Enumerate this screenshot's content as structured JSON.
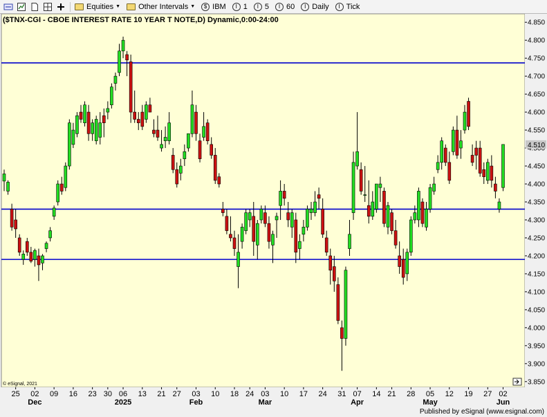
{
  "toolbar": {
    "items": [
      {
        "label": "Equities",
        "icon": "folder-icon",
        "dropdown": true
      },
      {
        "label": "Other Intervals",
        "icon": "folder-icon",
        "dropdown": true
      },
      {
        "label": "IBM",
        "icon": "symbol-icon",
        "glyph": "$"
      },
      {
        "label": "1",
        "icon": "interval-icon",
        "glyph": "I"
      },
      {
        "label": "5",
        "icon": "interval-icon",
        "glyph": "I"
      },
      {
        "label": "60",
        "icon": "interval-icon",
        "glyph": "I"
      },
      {
        "label": "Daily",
        "icon": "interval-icon",
        "glyph": "I"
      },
      {
        "label": "Tick",
        "icon": "interval-icon",
        "glyph": "I"
      }
    ]
  },
  "footer": {
    "published": "Published by eSignal (www.esignal.com)"
  },
  "chart_data": {
    "type": "candlestick",
    "title": "($TNX-CGI - CBOE INTEREST RATE 10 YEAR T NOTE,D) Dynamic,0:00-24:00",
    "copyright": "© eSignal, 2021",
    "ylim": [
      3.84,
      4.86
    ],
    "yticks": [
      "4.850",
      "4.800",
      "4.750",
      "4.700",
      "4.650",
      "4.600",
      "4.550",
      "4.500",
      "4.450",
      "4.400",
      "4.350",
      "4.300",
      "4.250",
      "4.200",
      "4.150",
      "4.100",
      "4.050",
      "4.000",
      "3.950",
      "3.900",
      "3.850"
    ],
    "last_price": "4.510",
    "horizontal_lines": [
      4.737,
      4.33,
      4.19
    ],
    "colors": {
      "up": "#22dd22",
      "down": "#cc1111",
      "background": "#ffffd6",
      "line": "#0000cc",
      "last_price_bg": "#c8c8c8"
    },
    "x_tick_labels": [
      {
        "i": 3,
        "label": "25",
        "month": ""
      },
      {
        "i": 8,
        "label": "02",
        "month": "Dec"
      },
      {
        "i": 13,
        "label": "09",
        "month": ""
      },
      {
        "i": 18,
        "label": "16",
        "month": ""
      },
      {
        "i": 23,
        "label": "23",
        "month": ""
      },
      {
        "i": 27,
        "label": "30",
        "month": ""
      },
      {
        "i": 31,
        "label": "06",
        "month": "2025"
      },
      {
        "i": 36,
        "label": "13",
        "month": ""
      },
      {
        "i": 41,
        "label": "21",
        "month": ""
      },
      {
        "i": 45,
        "label": "27",
        "month": ""
      },
      {
        "i": 50,
        "label": "03",
        "month": "Feb"
      },
      {
        "i": 55,
        "label": "10",
        "month": ""
      },
      {
        "i": 60,
        "label": "18",
        "month": ""
      },
      {
        "i": 64,
        "label": "24",
        "month": ""
      },
      {
        "i": 68,
        "label": "03",
        "month": "Mar"
      },
      {
        "i": 73,
        "label": "10",
        "month": ""
      },
      {
        "i": 78,
        "label": "17",
        "month": ""
      },
      {
        "i": 83,
        "label": "24",
        "month": ""
      },
      {
        "i": 88,
        "label": "31",
        "month": ""
      },
      {
        "i": 92,
        "label": "07",
        "month": "Apr"
      },
      {
        "i": 97,
        "label": "14",
        "month": ""
      },
      {
        "i": 101,
        "label": "21",
        "month": ""
      },
      {
        "i": 106,
        "label": "28",
        "month": ""
      },
      {
        "i": 111,
        "label": "05",
        "month": "May"
      },
      {
        "i": 116,
        "label": "12",
        "month": ""
      },
      {
        "i": 121,
        "label": "19",
        "month": ""
      },
      {
        "i": 126,
        "label": "27",
        "month": ""
      },
      {
        "i": 130,
        "label": "02",
        "month": "Jun"
      }
    ],
    "candles": [
      [
        4.408,
        4.44,
        4.38,
        4.428
      ],
      [
        4.38,
        4.41,
        4.37,
        4.405
      ],
      [
        4.33,
        4.345,
        4.27,
        4.28
      ],
      [
        4.3,
        4.33,
        4.25,
        4.275
      ],
      [
        4.25,
        4.26,
        4.2,
        4.21
      ],
      [
        4.19,
        4.215,
        4.175,
        4.205
      ],
      [
        4.24,
        4.25,
        4.2,
        4.21
      ],
      [
        4.21,
        4.225,
        4.18,
        4.185
      ],
      [
        4.19,
        4.22,
        4.17,
        4.215
      ],
      [
        4.2,
        4.22,
        4.13,
        4.175
      ],
      [
        4.18,
        4.205,
        4.16,
        4.2
      ],
      [
        4.22,
        4.24,
        4.21,
        4.235
      ],
      [
        4.25,
        4.28,
        4.24,
        4.27
      ],
      [
        4.31,
        4.34,
        4.3,
        4.333
      ],
      [
        4.35,
        4.41,
        4.34,
        4.4
      ],
      [
        4.4,
        4.42,
        4.37,
        4.38
      ],
      [
        4.39,
        4.46,
        4.38,
        4.45
      ],
      [
        4.45,
        4.58,
        4.44,
        4.57
      ],
      [
        4.51,
        4.57,
        4.5,
        4.55
      ],
      [
        4.54,
        4.6,
        4.53,
        4.59
      ],
      [
        4.6,
        4.62,
        4.57,
        4.58
      ],
      [
        4.57,
        4.63,
        4.56,
        4.62
      ],
      [
        4.6,
        4.62,
        4.52,
        4.54
      ],
      [
        4.54,
        4.58,
        4.52,
        4.57
      ],
      [
        4.52,
        4.59,
        4.51,
        4.58
      ],
      [
        4.53,
        4.6,
        4.51,
        4.57
      ],
      [
        4.59,
        4.61,
        4.53,
        4.57
      ],
      [
        4.6,
        4.63,
        4.58,
        4.61
      ],
      [
        4.62,
        4.68,
        4.61,
        4.67
      ],
      [
        4.68,
        4.71,
        4.66,
        4.7
      ],
      [
        4.71,
        4.79,
        4.7,
        4.77
      ],
      [
        4.77,
        4.81,
        4.75,
        4.8
      ],
      [
        4.76,
        4.77,
        4.7,
        4.745
      ],
      [
        4.74,
        4.76,
        4.57,
        4.6
      ],
      [
        4.6,
        4.66,
        4.57,
        4.58
      ],
      [
        4.58,
        4.6,
        4.55,
        4.57
      ],
      [
        4.6,
        4.62,
        4.55,
        4.56
      ],
      [
        4.58,
        4.63,
        4.57,
        4.62
      ],
      [
        4.62,
        4.64,
        4.6,
        4.6
      ],
      [
        4.55,
        4.58,
        4.53,
        4.54
      ],
      [
        4.55,
        4.59,
        4.52,
        4.53
      ],
      [
        4.5,
        4.55,
        4.49,
        4.51
      ],
      [
        4.52,
        4.56,
        4.5,
        4.53
      ],
      [
        4.52,
        4.6,
        4.51,
        4.57
      ],
      [
        4.48,
        4.5,
        4.43,
        4.44
      ],
      [
        4.44,
        4.46,
        4.39,
        4.4
      ],
      [
        4.43,
        4.47,
        4.41,
        4.45
      ],
      [
        4.47,
        4.51,
        4.45,
        4.49
      ],
      [
        4.5,
        4.54,
        4.49,
        4.54
      ],
      [
        4.54,
        4.66,
        4.53,
        4.62
      ],
      [
        4.6,
        4.62,
        4.52,
        4.54
      ],
      [
        4.52,
        4.54,
        4.46,
        4.47
      ],
      [
        4.53,
        4.6,
        4.52,
        4.56
      ],
      [
        4.57,
        4.58,
        4.51,
        4.52
      ],
      [
        4.51,
        4.53,
        4.47,
        4.48
      ],
      [
        4.48,
        4.5,
        4.4,
        4.41
      ],
      [
        4.42,
        4.43,
        4.39,
        4.4
      ],
      [
        4.33,
        4.35,
        4.31,
        4.32
      ],
      [
        4.31,
        4.33,
        4.26,
        4.27
      ],
      [
        4.26,
        4.31,
        4.24,
        4.25
      ],
      [
        4.25,
        4.27,
        4.2,
        4.22
      ],
      [
        4.17,
        4.26,
        4.11,
        4.21
      ],
      [
        4.24,
        4.29,
        4.22,
        4.28
      ],
      [
        4.27,
        4.33,
        4.26,
        4.32
      ],
      [
        4.3,
        4.33,
        4.28,
        4.32
      ],
      [
        4.31,
        4.35,
        4.2,
        4.24
      ],
      [
        4.23,
        4.3,
        4.19,
        4.29
      ],
      [
        4.3,
        4.34,
        4.29,
        4.33
      ],
      [
        4.32,
        4.34,
        4.28,
        4.29
      ],
      [
        4.29,
        4.31,
        4.22,
        4.24
      ],
      [
        4.23,
        4.27,
        4.18,
        4.26
      ],
      [
        4.3,
        4.32,
        4.25,
        4.31
      ],
      [
        4.34,
        4.41,
        4.3,
        4.38
      ],
      [
        4.38,
        4.4,
        4.34,
        4.36
      ],
      [
        4.32,
        4.35,
        4.28,
        4.3
      ],
      [
        4.28,
        4.33,
        4.25,
        4.32
      ],
      [
        4.3,
        4.32,
        4.18,
        4.21
      ],
      [
        4.22,
        4.26,
        4.19,
        4.24
      ],
      [
        4.26,
        4.3,
        4.24,
        4.28
      ],
      [
        4.28,
        4.34,
        4.27,
        4.33
      ],
      [
        4.32,
        4.35,
        4.3,
        4.33
      ],
      [
        4.32,
        4.38,
        4.31,
        4.35
      ],
      [
        4.37,
        4.39,
        4.33,
        4.36
      ],
      [
        4.33,
        4.36,
        4.25,
        4.26
      ],
      [
        4.25,
        4.27,
        4.2,
        4.21
      ],
      [
        4.2,
        4.22,
        4.12,
        4.16
      ],
      [
        4.17,
        4.2,
        4.1,
        4.13
      ],
      [
        4.12,
        4.14,
        4.01,
        4.02
      ],
      [
        4.0,
        4.02,
        3.88,
        3.97
      ],
      [
        3.97,
        4.17,
        3.95,
        4.16
      ],
      [
        4.22,
        4.3,
        4.2,
        4.26
      ],
      [
        4.32,
        4.49,
        4.3,
        4.46
      ],
      [
        4.45,
        4.6,
        4.44,
        4.49
      ],
      [
        4.44,
        4.46,
        4.37,
        4.38
      ],
      [
        4.37,
        4.45,
        4.35,
        4.37
      ],
      [
        4.34,
        4.41,
        4.29,
        4.31
      ],
      [
        4.31,
        4.38,
        4.3,
        4.35
      ],
      [
        4.33,
        4.4,
        4.32,
        4.4
      ],
      [
        4.39,
        4.42,
        4.35,
        4.4
      ],
      [
        4.38,
        4.39,
        4.28,
        4.29
      ],
      [
        4.28,
        4.35,
        4.26,
        4.34
      ],
      [
        4.32,
        4.33,
        4.26,
        4.27
      ],
      [
        4.27,
        4.3,
        4.22,
        4.23
      ],
      [
        4.2,
        4.24,
        4.15,
        4.17
      ],
      [
        4.19,
        4.22,
        4.12,
        4.14
      ],
      [
        4.15,
        4.22,
        4.13,
        4.21
      ],
      [
        4.21,
        4.31,
        4.2,
        4.3
      ],
      [
        4.3,
        4.34,
        4.29,
        4.32
      ],
      [
        4.3,
        4.39,
        4.28,
        4.38
      ],
      [
        4.35,
        4.36,
        4.28,
        4.29
      ],
      [
        4.28,
        4.35,
        4.27,
        4.33
      ],
      [
        4.33,
        4.4,
        4.32,
        4.39
      ],
      [
        4.38,
        4.42,
        4.37,
        4.4
      ],
      [
        4.44,
        4.48,
        4.43,
        4.46
      ],
      [
        4.46,
        4.53,
        4.44,
        4.52
      ],
      [
        4.5,
        4.51,
        4.45,
        4.46
      ],
      [
        4.46,
        4.49,
        4.4,
        4.41
      ],
      [
        4.49,
        4.56,
        4.48,
        4.55
      ],
      [
        4.55,
        4.59,
        4.47,
        4.48
      ],
      [
        4.5,
        4.55,
        4.47,
        4.52
      ],
      [
        4.55,
        4.62,
        4.54,
        4.6
      ],
      [
        4.63,
        4.64,
        4.55,
        4.56
      ],
      [
        4.48,
        4.51,
        4.45,
        4.46
      ],
      [
        4.5,
        4.52,
        4.44,
        4.48
      ],
      [
        4.5,
        4.52,
        4.42,
        4.43
      ],
      [
        4.44,
        4.46,
        4.4,
        4.42
      ],
      [
        4.41,
        4.47,
        4.4,
        4.46
      ],
      [
        4.45,
        4.48,
        4.39,
        4.41
      ],
      [
        4.4,
        4.42,
        4.36,
        4.38
      ],
      [
        4.33,
        4.36,
        4.32,
        4.35
      ],
      [
        4.39,
        4.51,
        4.38,
        4.51
      ]
    ]
  }
}
